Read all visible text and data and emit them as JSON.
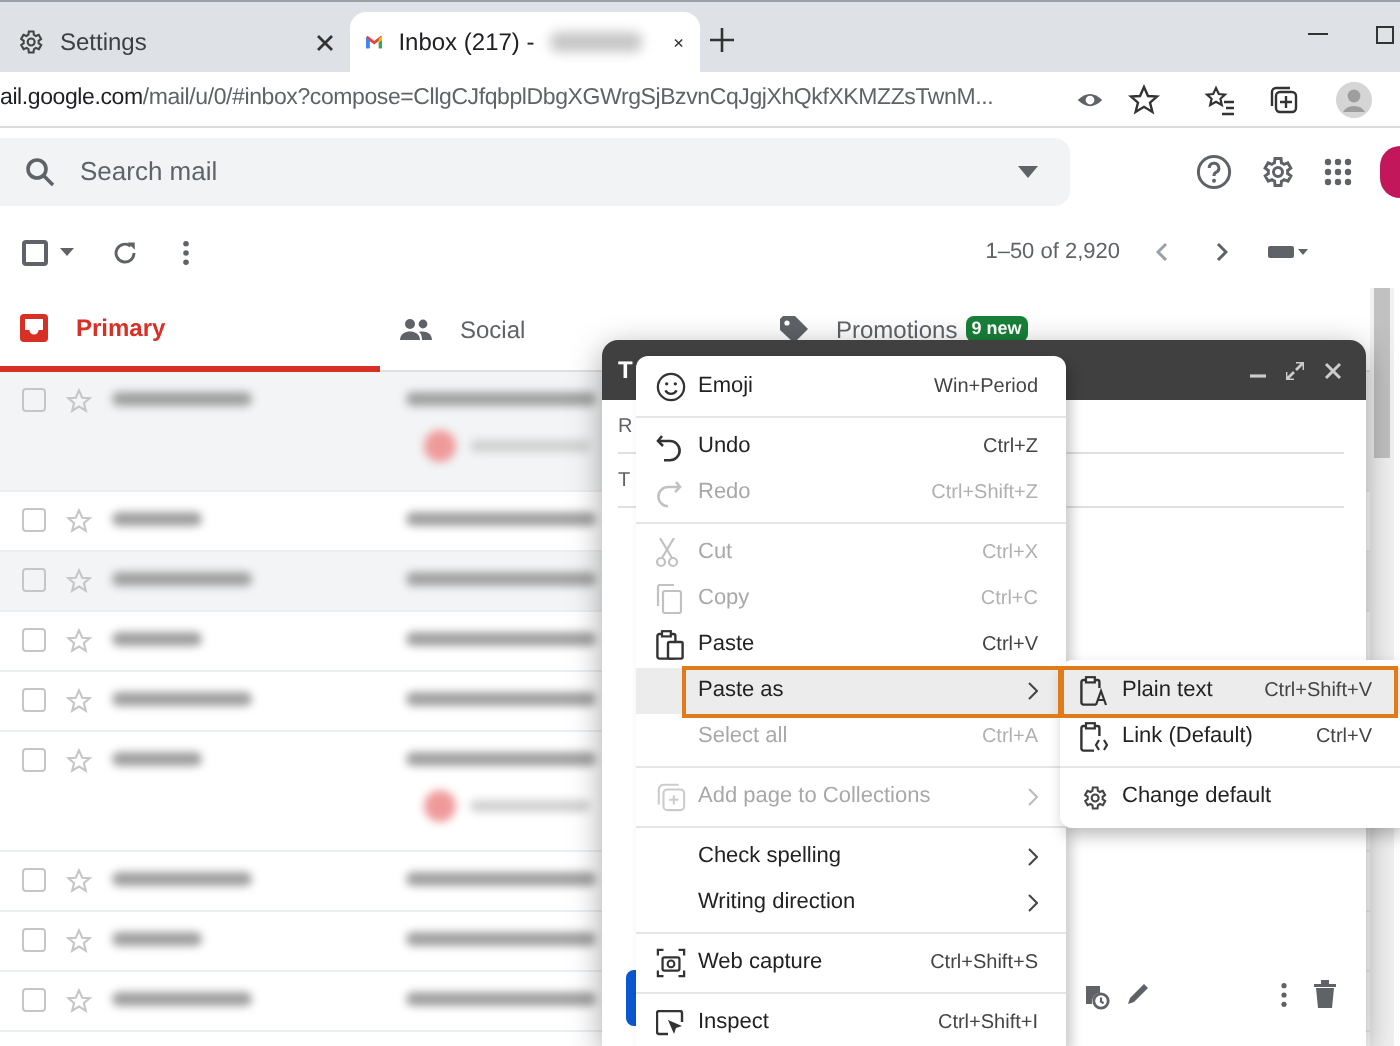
{
  "browser": {
    "tabs": [
      {
        "title": "Settings",
        "selected": false
      },
      {
        "title": "Inbox (217) -",
        "selected": true
      }
    ],
    "address": {
      "host": "ail.google.com",
      "path": "/mail/u/0/#inbox?compose=CllgCJfqbplDbgXGWrgSjBzvnCqJgjXhQkfXKMZZsTwnM..."
    }
  },
  "gmail": {
    "search": {
      "placeholder": "Search mail"
    },
    "select_all": {
      "checked": false
    },
    "pagination": "1–50 of 2,920",
    "categories": [
      {
        "label": "Primary",
        "selected": true
      },
      {
        "label": "Social",
        "selected": false
      },
      {
        "label": "Promotions",
        "selected": false,
        "badge": "9 new"
      }
    ],
    "rows": [
      {
        "kind": "double",
        "read": true,
        "checked": false,
        "starred": false
      },
      {
        "kind": "single",
        "read": false,
        "checked": false,
        "starred": false
      },
      {
        "kind": "single",
        "read": true,
        "checked": false,
        "starred": false
      },
      {
        "kind": "single",
        "read": false,
        "checked": false,
        "starred": false
      },
      {
        "kind": "single",
        "read": false,
        "checked": false,
        "starred": false
      },
      {
        "kind": "double",
        "read": false,
        "checked": false,
        "starred": false
      },
      {
        "kind": "single",
        "read": false,
        "checked": false,
        "starred": false
      },
      {
        "kind": "single",
        "read": false,
        "checked": false,
        "starred": false
      },
      {
        "kind": "single",
        "read": false,
        "checked": false,
        "starred": false
      }
    ]
  },
  "compose": {
    "title": "T",
    "fields": [
      "R",
      "T"
    ]
  },
  "context_menu": {
    "items": [
      {
        "kind": "item",
        "label": "Emoji",
        "shortcut": "Win+Period",
        "disabled": false,
        "selected": false
      },
      {
        "kind": "separator"
      },
      {
        "kind": "item",
        "label": "Undo",
        "shortcut": "Ctrl+Z",
        "disabled": false,
        "selected": false
      },
      {
        "kind": "item",
        "label": "Redo",
        "shortcut": "Ctrl+Shift+Z",
        "disabled": true,
        "selected": false
      },
      {
        "kind": "separator"
      },
      {
        "kind": "item",
        "label": "Cut",
        "shortcut": "Ctrl+X",
        "disabled": true,
        "selected": false
      },
      {
        "kind": "item",
        "label": "Copy",
        "shortcut": "Ctrl+C",
        "disabled": true,
        "selected": false
      },
      {
        "kind": "item",
        "label": "Paste",
        "shortcut": "Ctrl+V",
        "disabled": false,
        "selected": false
      },
      {
        "kind": "submenu",
        "label": "Paste as",
        "disabled": false,
        "selected": true
      },
      {
        "kind": "item",
        "label": "Select all",
        "shortcut": "Ctrl+A",
        "disabled": true,
        "selected": false
      },
      {
        "kind": "separator"
      },
      {
        "kind": "submenu",
        "label": "Add page to Collections",
        "disabled": true,
        "selected": false
      },
      {
        "kind": "separator"
      },
      {
        "kind": "submenu",
        "label": "Check spelling",
        "disabled": false,
        "selected": false
      },
      {
        "kind": "submenu",
        "label": "Writing direction",
        "disabled": false,
        "selected": false
      },
      {
        "kind": "separator"
      },
      {
        "kind": "item",
        "label": "Web capture",
        "shortcut": "Ctrl+Shift+S",
        "disabled": false,
        "selected": false
      },
      {
        "kind": "separator"
      },
      {
        "kind": "item",
        "label": "Inspect",
        "shortcut": "Ctrl+Shift+I",
        "disabled": false,
        "selected": false
      }
    ]
  },
  "submenu": {
    "items": [
      {
        "kind": "item",
        "label": "Plain text",
        "shortcut": "Ctrl+Shift+V",
        "selected": true
      },
      {
        "kind": "item",
        "label": "Link (Default)",
        "shortcut": "Ctrl+V",
        "selected": false
      },
      {
        "kind": "separator"
      },
      {
        "kind": "item",
        "label": "Change default",
        "selected": false
      }
    ]
  }
}
